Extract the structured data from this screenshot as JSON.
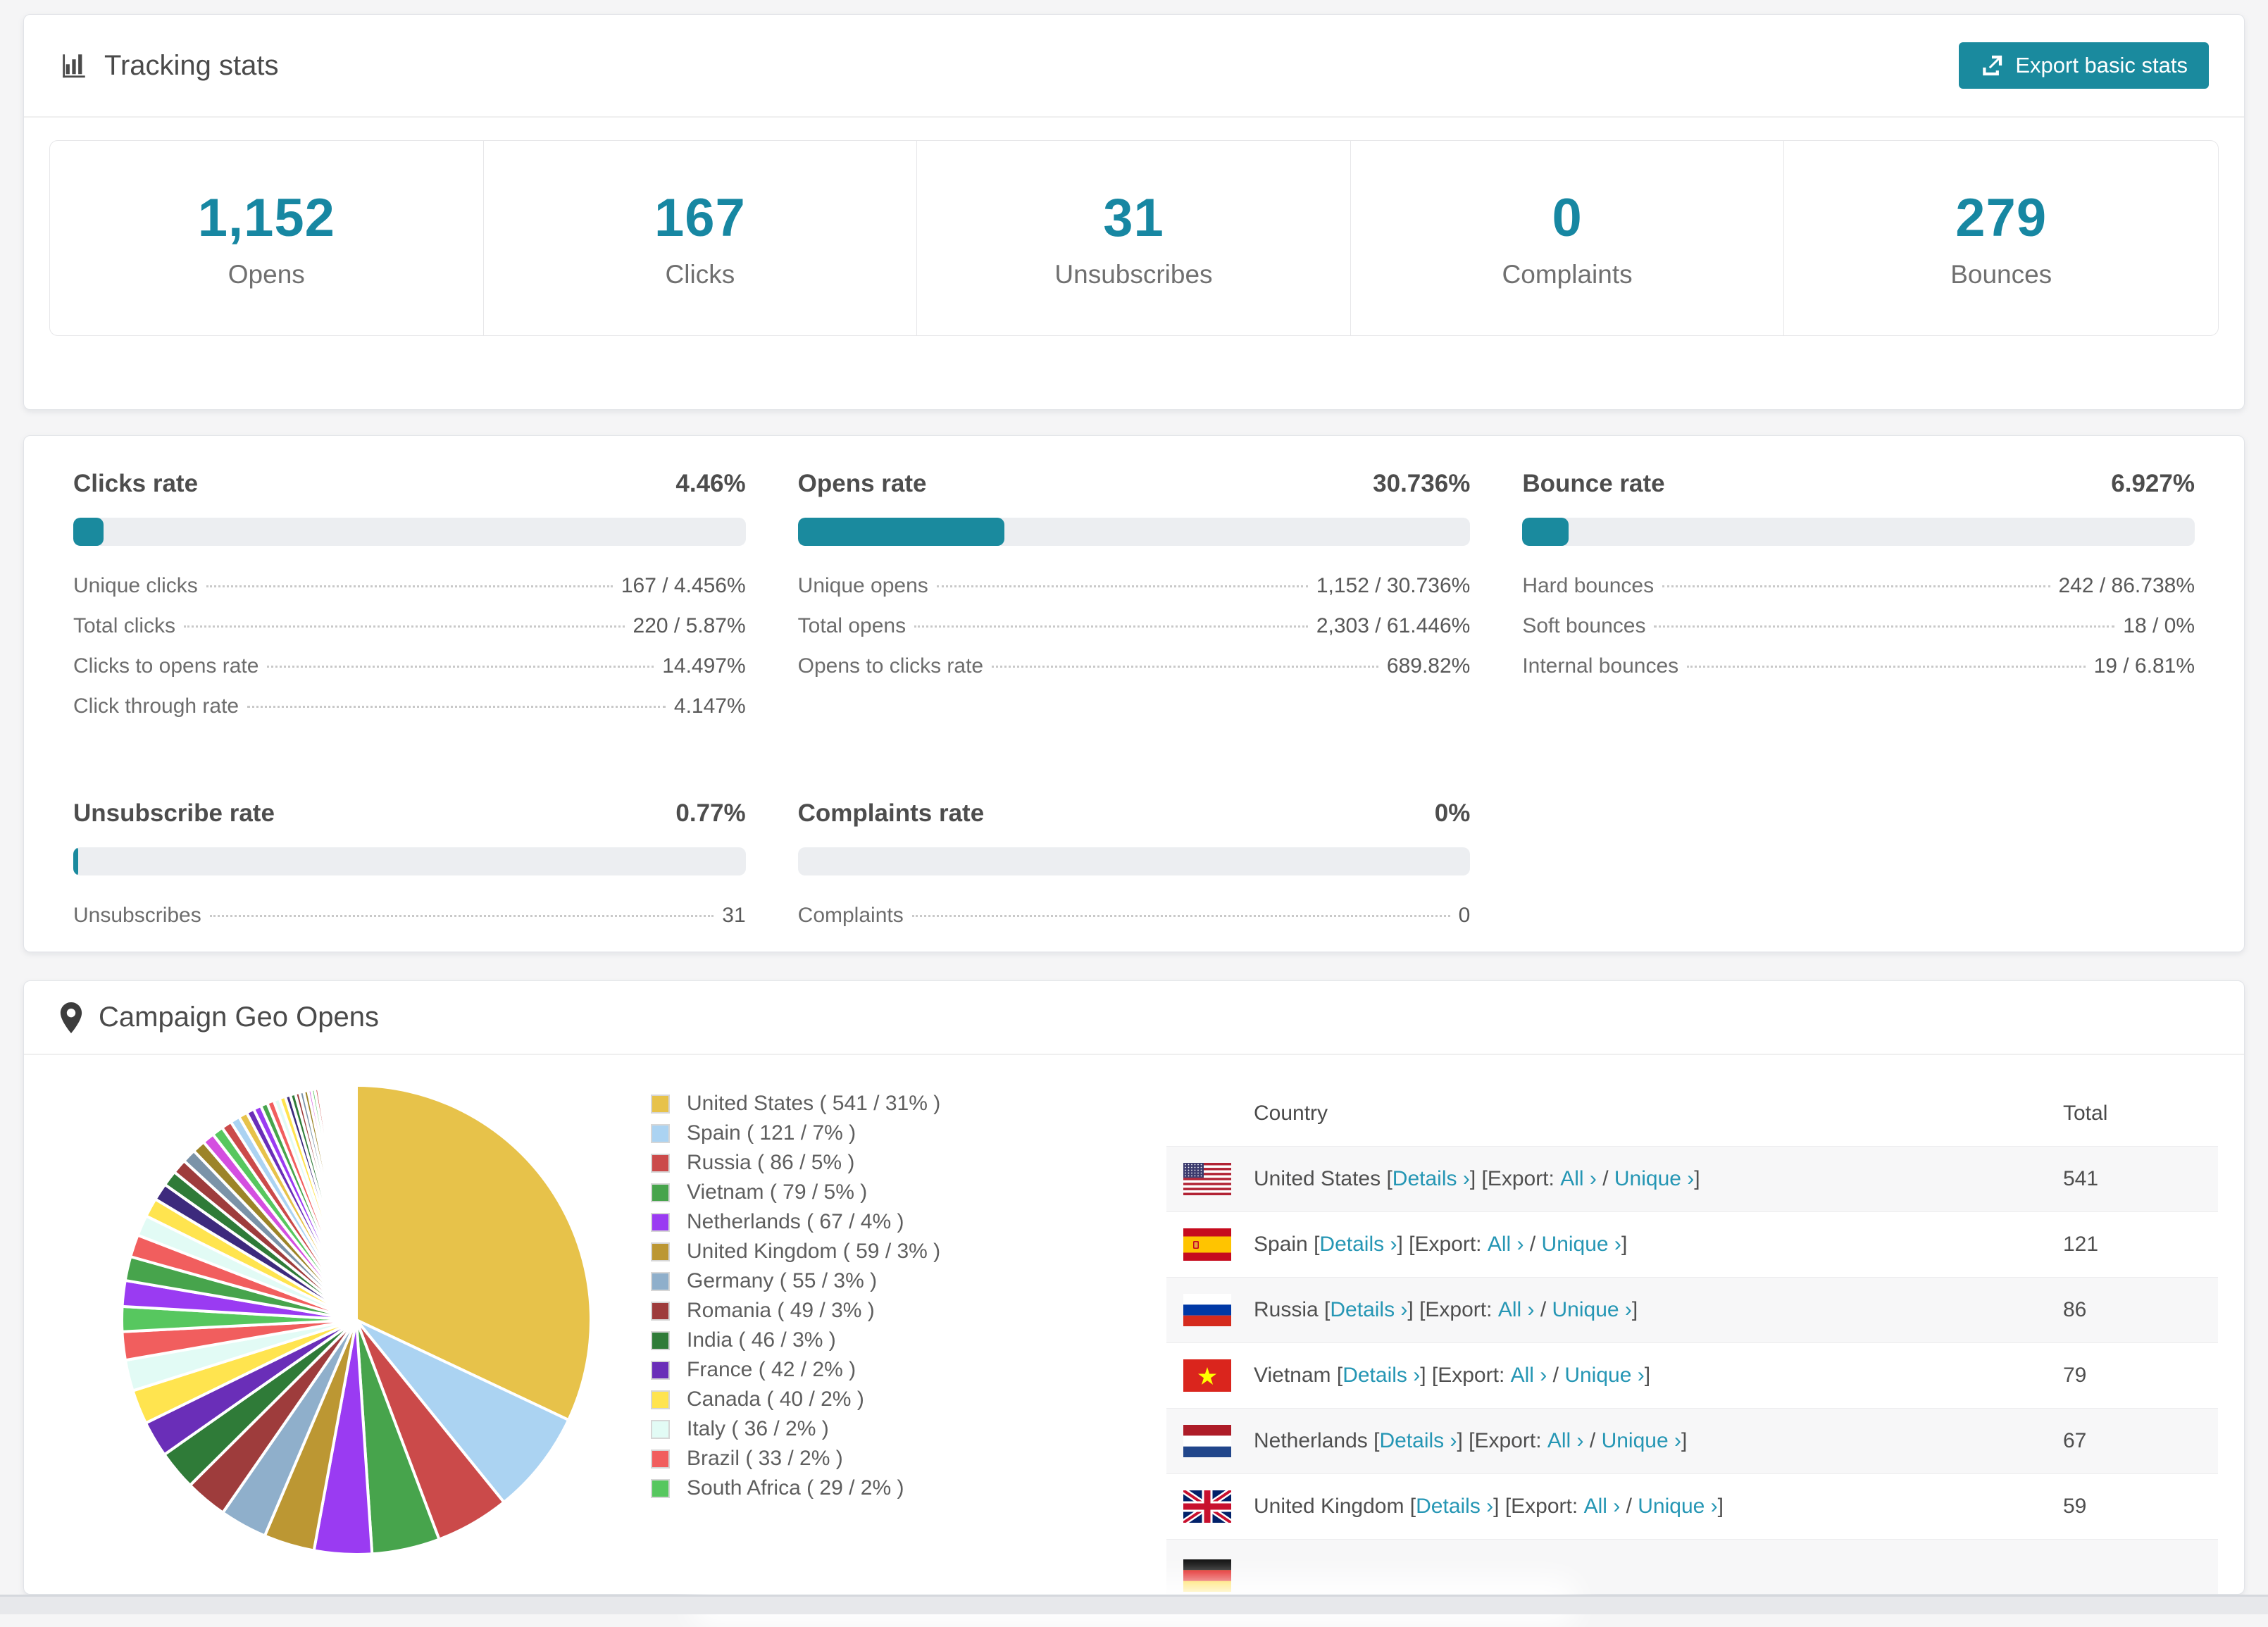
{
  "colors": {
    "accent": "#1a8a9e",
    "stat_number": "#1787a2",
    "link": "#2596b4",
    "progress_track": "#eceef1",
    "page_background": "#f5f5f6"
  },
  "tracking": {
    "title": "Tracking stats",
    "export_button": "Export basic stats",
    "stats": [
      {
        "value": "1,152",
        "label": "Opens"
      },
      {
        "value": "167",
        "label": "Clicks"
      },
      {
        "value": "31",
        "label": "Unsubscribes"
      },
      {
        "value": "0",
        "label": "Complaints"
      },
      {
        "value": "279",
        "label": "Bounces"
      }
    ]
  },
  "rates": {
    "cards": [
      {
        "title": "Clicks rate",
        "percent": "4.46%",
        "fill_pct": 4.46,
        "rows": [
          {
            "label": "Unique clicks",
            "value": "167 / 4.456%"
          },
          {
            "label": "Total clicks",
            "value": "220 / 5.87%"
          },
          {
            "label": "Clicks to opens rate",
            "value": "14.497%"
          },
          {
            "label": "Click through rate",
            "value": "4.147%"
          }
        ]
      },
      {
        "title": "Opens rate",
        "percent": "30.736%",
        "fill_pct": 30.736,
        "rows": [
          {
            "label": "Unique opens",
            "value": "1,152 / 30.736%"
          },
          {
            "label": "Total opens",
            "value": "2,303 / 61.446%"
          },
          {
            "label": "Opens to clicks rate",
            "value": "689.82%"
          }
        ]
      },
      {
        "title": "Bounce rate",
        "percent": "6.927%",
        "fill_pct": 6.927,
        "rows": [
          {
            "label": "Hard bounces",
            "value": "242 / 86.738%"
          },
          {
            "label": "Soft bounces",
            "value": "18 / 0%"
          },
          {
            "label": "Internal bounces",
            "value": "19 / 6.81%"
          }
        ]
      },
      {
        "title": "Unsubscribe rate",
        "percent": "0.77%",
        "fill_pct": 0.77,
        "rows": [
          {
            "label": "Unsubscribes",
            "value": "31"
          }
        ]
      },
      {
        "title": "Complaints rate",
        "percent": "0%",
        "fill_pct": 0,
        "rows": [
          {
            "label": "Complaints",
            "value": "0"
          }
        ]
      }
    ]
  },
  "geo": {
    "title": "Campaign Geo Opens",
    "legend": [
      {
        "text": "United States ( 541 / 31% )",
        "color": "#E7C24A"
      },
      {
        "text": "Spain ( 121 / 7% )",
        "color": "#ABD3F2"
      },
      {
        "text": "Russia ( 86 / 5% )",
        "color": "#CB4A4A"
      },
      {
        "text": "Vietnam ( 79 / 5% )",
        "color": "#47A44C"
      },
      {
        "text": "Netherlands ( 67 / 4% )",
        "color": "#9A3BF2"
      },
      {
        "text": "United Kingdom ( 59 / 3% )",
        "color": "#BC9733"
      },
      {
        "text": "Germany ( 55 / 3% )",
        "color": "#8FAFCB"
      },
      {
        "text": "Romania ( 49 / 3% )",
        "color": "#9E3C3C"
      },
      {
        "text": "India ( 46 / 3% )",
        "color": "#2F7B38"
      },
      {
        "text": "France ( 42 / 2% )",
        "color": "#6A2EB8"
      },
      {
        "text": "Canada ( 40 / 2% )",
        "color": "#FFE44F"
      },
      {
        "text": "Italy ( 36 / 2% )",
        "color": "#E2FBF5"
      },
      {
        "text": "Brazil ( 33 / 2% )",
        "color": "#F15E5E"
      },
      {
        "text": "South Africa ( 29 / 2% )",
        "color": "#57C75F"
      }
    ],
    "table": {
      "headers": {
        "country": "Country",
        "total": "Total"
      },
      "labels": {
        "details": "Details ›",
        "export": "Export:",
        "all": "All ›",
        "unique": "Unique ›",
        "open": "[",
        "close": "]",
        "slash": "/"
      },
      "rows": [
        {
          "name": "United States",
          "flag": "us",
          "total": "541"
        },
        {
          "name": "Spain",
          "flag": "es",
          "total": "121"
        },
        {
          "name": "Russia",
          "flag": "ru",
          "total": "86"
        },
        {
          "name": "Vietnam",
          "flag": "vn",
          "total": "79"
        },
        {
          "name": "Netherlands",
          "flag": "nl",
          "total": "67"
        },
        {
          "name": "United Kingdom",
          "flag": "gb",
          "total": "59"
        }
      ],
      "partial_row": {
        "flag": "de"
      }
    },
    "chart_data": {
      "type": "pie",
      "title": "Campaign Geo Opens",
      "legend_position": "right",
      "series": [
        {
          "name": "United States",
          "value": 541,
          "color": "#E7C24A"
        },
        {
          "name": "Spain",
          "value": 121,
          "color": "#ABD3F2"
        },
        {
          "name": "Russia",
          "value": 86,
          "color": "#CB4A4A"
        },
        {
          "name": "Vietnam",
          "value": 79,
          "color": "#47A44C"
        },
        {
          "name": "Netherlands",
          "value": 67,
          "color": "#9A3BF2"
        },
        {
          "name": "United Kingdom",
          "value": 59,
          "color": "#BC9733"
        },
        {
          "name": "Germany",
          "value": 55,
          "color": "#8FAFCB"
        },
        {
          "name": "Romania",
          "value": 49,
          "color": "#9E3C3C"
        },
        {
          "name": "India",
          "value": 46,
          "color": "#2F7B38"
        },
        {
          "name": "France",
          "value": 42,
          "color": "#6A2EB8"
        },
        {
          "name": "Canada",
          "value": 40,
          "color": "#FFE44F"
        },
        {
          "name": "Italy",
          "value": 36,
          "color": "#E2FBF5"
        },
        {
          "name": "Brazil",
          "value": 33,
          "color": "#F15E5E"
        },
        {
          "name": "South Africa",
          "value": 29,
          "color": "#57C75F"
        }
      ],
      "others": {
        "values": [
          30,
          28,
          26,
          24,
          22,
          20,
          18,
          17,
          16,
          15,
          14,
          13,
          12,
          11,
          10,
          9,
          9,
          8,
          8,
          7,
          7,
          6,
          6,
          5,
          5,
          5,
          4,
          4,
          4,
          3,
          3,
          3,
          3,
          2,
          2,
          2,
          2,
          2,
          2,
          2,
          1,
          1,
          1,
          1,
          1,
          1,
          1,
          1,
          1,
          1,
          1,
          1,
          1,
          1,
          1,
          1,
          1,
          1
        ],
        "palette": [
          "#9A3BF2",
          "#47A44C",
          "#F15E5E",
          "#E2FBF5",
          "#FFE44F",
          "#3D2A7D",
          "#2F7B38",
          "#9E3C3C",
          "#7B93A8",
          "#9C8428",
          "#D44FE0",
          "#57C75F",
          "#CB4A4A",
          "#ABD3F2",
          "#E7C24A",
          "#6A2EB8"
        ]
      }
    }
  }
}
